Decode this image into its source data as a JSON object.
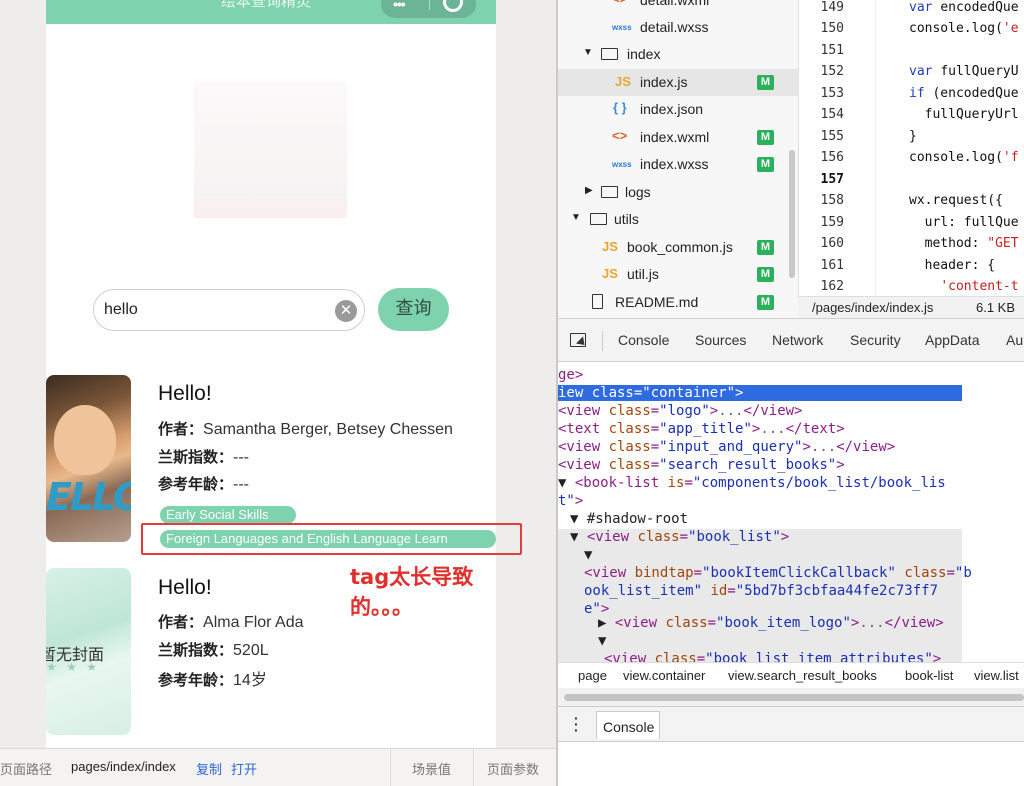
{
  "simulator": {
    "nav_title": "绘本查询精灵",
    "search_value": "hello",
    "clear_glyph": "✕",
    "query_button": "查询",
    "books": [
      {
        "title": "Hello!",
        "author_label": "作者：",
        "author": "Samantha Berger, Betsey Chessen",
        "lexile_label": "兰斯指数：",
        "lexile": "---",
        "age_label": "参考年龄：",
        "age": "---",
        "cover_text": "ELLO!",
        "tags": [
          "Early Social Skills",
          "Foreign Languages and English Language Learn"
        ]
      },
      {
        "title": "Hello!",
        "author_label": "作者：",
        "author": "Alma Flor Ada",
        "lexile_label": "兰斯指数：",
        "lexile": "520L",
        "age_label": "参考年龄：",
        "age": "14岁",
        "cover_text": "暂无封面",
        "cover_stars": "★ ★ ★"
      }
    ],
    "annotation": [
      "tag太长导致",
      "的。。。"
    ]
  },
  "status_bar": {
    "path_label": "页面路径",
    "path": "pages/index/index",
    "copy": "复制",
    "open": "打开",
    "scene": "场景值",
    "params": "页面参数"
  },
  "file_tree": {
    "items": [
      {
        "name": "detail.wxml",
        "icon": "xml-icon",
        "badge": ""
      },
      {
        "name": "detail.wxss",
        "icon": "wxss-icon",
        "badge": ""
      },
      {
        "name": "index",
        "icon": "folder-open-icon",
        "badge": ""
      },
      {
        "name": "index.js",
        "icon": "js-icon",
        "badge": "M"
      },
      {
        "name": "index.json",
        "icon": "json-icon",
        "badge": ""
      },
      {
        "name": "index.wxml",
        "icon": "xml-icon",
        "badge": "M"
      },
      {
        "name": "index.wxss",
        "icon": "wxss-icon",
        "badge": "M"
      },
      {
        "name": "logs",
        "icon": "folder-icon",
        "badge": ""
      },
      {
        "name": "utils",
        "icon": "folder-open-icon",
        "badge": ""
      },
      {
        "name": "book_common.js",
        "icon": "js-icon",
        "badge": "M"
      },
      {
        "name": "util.js",
        "icon": "js-icon",
        "badge": "M"
      },
      {
        "name": "README.md",
        "icon": "file-icon",
        "badge": "M"
      }
    ],
    "wxss_glyph": "wxss",
    "xml_glyph": "<>",
    "js_glyph": "JS",
    "json_glyph": "{ }"
  },
  "editor": {
    "line_numbers": [
      "149",
      "150",
      "151",
      "152",
      "153",
      "154",
      "155",
      "156",
      "157",
      "158",
      "159",
      "160",
      "161",
      "162"
    ],
    "current_line": "157",
    "lines": [
      {
        "kw": "var ",
        "text": "encodedQue",
        "str": ""
      },
      {
        "kw": "",
        "text": "console.log(",
        "str": "'e"
      },
      {
        "kw": "",
        "text": "",
        "str": ""
      },
      {
        "kw": "var ",
        "text": "fullQueryU",
        "str": ""
      },
      {
        "kw": "if ",
        "text": "(encodedQue",
        "str": ""
      },
      {
        "kw": "",
        "text": "  fullQueryUrl",
        "str": ""
      },
      {
        "kw": "",
        "text": "}",
        "str": ""
      },
      {
        "kw": "",
        "text": "console.log(",
        "str": "'f"
      },
      {
        "kw": "",
        "text": "",
        "str": ""
      },
      {
        "kw": "",
        "text": "wx.request({",
        "str": ""
      },
      {
        "kw": "",
        "text": "  url: fullQue",
        "str": ""
      },
      {
        "kw": "",
        "text": "  method: ",
        "str": "\"GET"
      },
      {
        "kw": "",
        "text": "  header: {",
        "str": ""
      },
      {
        "kw": "",
        "text": "    ",
        "str": "'content-t"
      }
    ],
    "file_path": "/pages/index/index.js",
    "file_size": "6.1 KB"
  },
  "devtools": {
    "tabs": [
      "Console",
      "Sources",
      "Network",
      "Security",
      "AppData",
      "Au"
    ],
    "breadcrumb": [
      "page",
      "view.container",
      "view.search_result_books",
      "book-list",
      "view.list"
    ],
    "drawer_tab": "Console"
  }
}
